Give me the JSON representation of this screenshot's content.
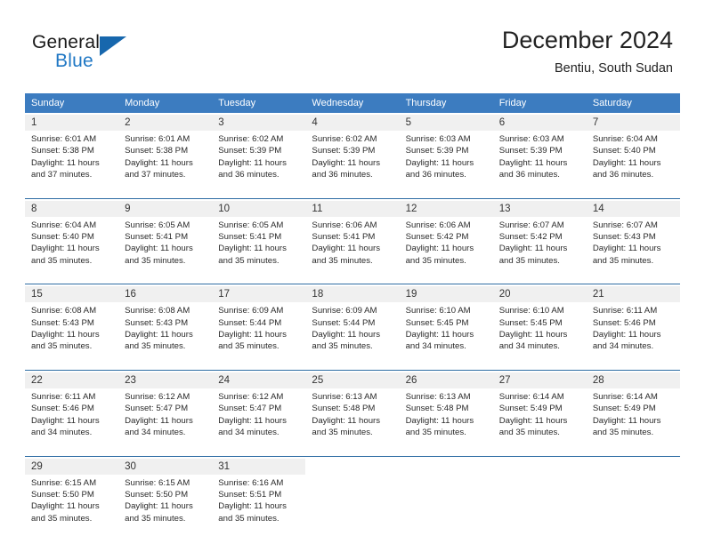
{
  "brand": {
    "name_part1": "General",
    "name_part2": "Blue",
    "triangle_color": "#1767ad",
    "blue_color": "#1f77c4"
  },
  "header": {
    "month_title": "December 2024",
    "location": "Bentiu, South Sudan"
  },
  "theme": {
    "header_row_bg": "#3c7cc0",
    "daynum_bg": "#f0f0f0",
    "separator_color": "#2e6da4",
    "text_color": "#2a2a2a"
  },
  "calendar": {
    "weekday_headers": [
      "Sunday",
      "Monday",
      "Tuesday",
      "Wednesday",
      "Thursday",
      "Friday",
      "Saturday"
    ],
    "weeks": [
      {
        "days": [
          {
            "num": "1",
            "sunrise": "Sunrise: 6:01 AM",
            "sunset": "Sunset: 5:38 PM",
            "daylight_1": "Daylight: 11 hours",
            "daylight_2": "and 37 minutes."
          },
          {
            "num": "2",
            "sunrise": "Sunrise: 6:01 AM",
            "sunset": "Sunset: 5:38 PM",
            "daylight_1": "Daylight: 11 hours",
            "daylight_2": "and 37 minutes."
          },
          {
            "num": "3",
            "sunrise": "Sunrise: 6:02 AM",
            "sunset": "Sunset: 5:39 PM",
            "daylight_1": "Daylight: 11 hours",
            "daylight_2": "and 36 minutes."
          },
          {
            "num": "4",
            "sunrise": "Sunrise: 6:02 AM",
            "sunset": "Sunset: 5:39 PM",
            "daylight_1": "Daylight: 11 hours",
            "daylight_2": "and 36 minutes."
          },
          {
            "num": "5",
            "sunrise": "Sunrise: 6:03 AM",
            "sunset": "Sunset: 5:39 PM",
            "daylight_1": "Daylight: 11 hours",
            "daylight_2": "and 36 minutes."
          },
          {
            "num": "6",
            "sunrise": "Sunrise: 6:03 AM",
            "sunset": "Sunset: 5:39 PM",
            "daylight_1": "Daylight: 11 hours",
            "daylight_2": "and 36 minutes."
          },
          {
            "num": "7",
            "sunrise": "Sunrise: 6:04 AM",
            "sunset": "Sunset: 5:40 PM",
            "daylight_1": "Daylight: 11 hours",
            "daylight_2": "and 36 minutes."
          }
        ]
      },
      {
        "days": [
          {
            "num": "8",
            "sunrise": "Sunrise: 6:04 AM",
            "sunset": "Sunset: 5:40 PM",
            "daylight_1": "Daylight: 11 hours",
            "daylight_2": "and 35 minutes."
          },
          {
            "num": "9",
            "sunrise": "Sunrise: 6:05 AM",
            "sunset": "Sunset: 5:41 PM",
            "daylight_1": "Daylight: 11 hours",
            "daylight_2": "and 35 minutes."
          },
          {
            "num": "10",
            "sunrise": "Sunrise: 6:05 AM",
            "sunset": "Sunset: 5:41 PM",
            "daylight_1": "Daylight: 11 hours",
            "daylight_2": "and 35 minutes."
          },
          {
            "num": "11",
            "sunrise": "Sunrise: 6:06 AM",
            "sunset": "Sunset: 5:41 PM",
            "daylight_1": "Daylight: 11 hours",
            "daylight_2": "and 35 minutes."
          },
          {
            "num": "12",
            "sunrise": "Sunrise: 6:06 AM",
            "sunset": "Sunset: 5:42 PM",
            "daylight_1": "Daylight: 11 hours",
            "daylight_2": "and 35 minutes."
          },
          {
            "num": "13",
            "sunrise": "Sunrise: 6:07 AM",
            "sunset": "Sunset: 5:42 PM",
            "daylight_1": "Daylight: 11 hours",
            "daylight_2": "and 35 minutes."
          },
          {
            "num": "14",
            "sunrise": "Sunrise: 6:07 AM",
            "sunset": "Sunset: 5:43 PM",
            "daylight_1": "Daylight: 11 hours",
            "daylight_2": "and 35 minutes."
          }
        ]
      },
      {
        "days": [
          {
            "num": "15",
            "sunrise": "Sunrise: 6:08 AM",
            "sunset": "Sunset: 5:43 PM",
            "daylight_1": "Daylight: 11 hours",
            "daylight_2": "and 35 minutes."
          },
          {
            "num": "16",
            "sunrise": "Sunrise: 6:08 AM",
            "sunset": "Sunset: 5:43 PM",
            "daylight_1": "Daylight: 11 hours",
            "daylight_2": "and 35 minutes."
          },
          {
            "num": "17",
            "sunrise": "Sunrise: 6:09 AM",
            "sunset": "Sunset: 5:44 PM",
            "daylight_1": "Daylight: 11 hours",
            "daylight_2": "and 35 minutes."
          },
          {
            "num": "18",
            "sunrise": "Sunrise: 6:09 AM",
            "sunset": "Sunset: 5:44 PM",
            "daylight_1": "Daylight: 11 hours",
            "daylight_2": "and 35 minutes."
          },
          {
            "num": "19",
            "sunrise": "Sunrise: 6:10 AM",
            "sunset": "Sunset: 5:45 PM",
            "daylight_1": "Daylight: 11 hours",
            "daylight_2": "and 34 minutes."
          },
          {
            "num": "20",
            "sunrise": "Sunrise: 6:10 AM",
            "sunset": "Sunset: 5:45 PM",
            "daylight_1": "Daylight: 11 hours",
            "daylight_2": "and 34 minutes."
          },
          {
            "num": "21",
            "sunrise": "Sunrise: 6:11 AM",
            "sunset": "Sunset: 5:46 PM",
            "daylight_1": "Daylight: 11 hours",
            "daylight_2": "and 34 minutes."
          }
        ]
      },
      {
        "days": [
          {
            "num": "22",
            "sunrise": "Sunrise: 6:11 AM",
            "sunset": "Sunset: 5:46 PM",
            "daylight_1": "Daylight: 11 hours",
            "daylight_2": "and 34 minutes."
          },
          {
            "num": "23",
            "sunrise": "Sunrise: 6:12 AM",
            "sunset": "Sunset: 5:47 PM",
            "daylight_1": "Daylight: 11 hours",
            "daylight_2": "and 34 minutes."
          },
          {
            "num": "24",
            "sunrise": "Sunrise: 6:12 AM",
            "sunset": "Sunset: 5:47 PM",
            "daylight_1": "Daylight: 11 hours",
            "daylight_2": "and 34 minutes."
          },
          {
            "num": "25",
            "sunrise": "Sunrise: 6:13 AM",
            "sunset": "Sunset: 5:48 PM",
            "daylight_1": "Daylight: 11 hours",
            "daylight_2": "and 35 minutes."
          },
          {
            "num": "26",
            "sunrise": "Sunrise: 6:13 AM",
            "sunset": "Sunset: 5:48 PM",
            "daylight_1": "Daylight: 11 hours",
            "daylight_2": "and 35 minutes."
          },
          {
            "num": "27",
            "sunrise": "Sunrise: 6:14 AM",
            "sunset": "Sunset: 5:49 PM",
            "daylight_1": "Daylight: 11 hours",
            "daylight_2": "and 35 minutes."
          },
          {
            "num": "28",
            "sunrise": "Sunrise: 6:14 AM",
            "sunset": "Sunset: 5:49 PM",
            "daylight_1": "Daylight: 11 hours",
            "daylight_2": "and 35 minutes."
          }
        ]
      },
      {
        "days": [
          {
            "num": "29",
            "sunrise": "Sunrise: 6:15 AM",
            "sunset": "Sunset: 5:50 PM",
            "daylight_1": "Daylight: 11 hours",
            "daylight_2": "and 35 minutes."
          },
          {
            "num": "30",
            "sunrise": "Sunrise: 6:15 AM",
            "sunset": "Sunset: 5:50 PM",
            "daylight_1": "Daylight: 11 hours",
            "daylight_2": "and 35 minutes."
          },
          {
            "num": "31",
            "sunrise": "Sunrise: 6:16 AM",
            "sunset": "Sunset: 5:51 PM",
            "daylight_1": "Daylight: 11 hours",
            "daylight_2": "and 35 minutes."
          },
          {
            "num": "",
            "sunrise": "",
            "sunset": "",
            "daylight_1": "",
            "daylight_2": ""
          },
          {
            "num": "",
            "sunrise": "",
            "sunset": "",
            "daylight_1": "",
            "daylight_2": ""
          },
          {
            "num": "",
            "sunrise": "",
            "sunset": "",
            "daylight_1": "",
            "daylight_2": ""
          },
          {
            "num": "",
            "sunrise": "",
            "sunset": "",
            "daylight_1": "",
            "daylight_2": ""
          }
        ]
      }
    ]
  }
}
